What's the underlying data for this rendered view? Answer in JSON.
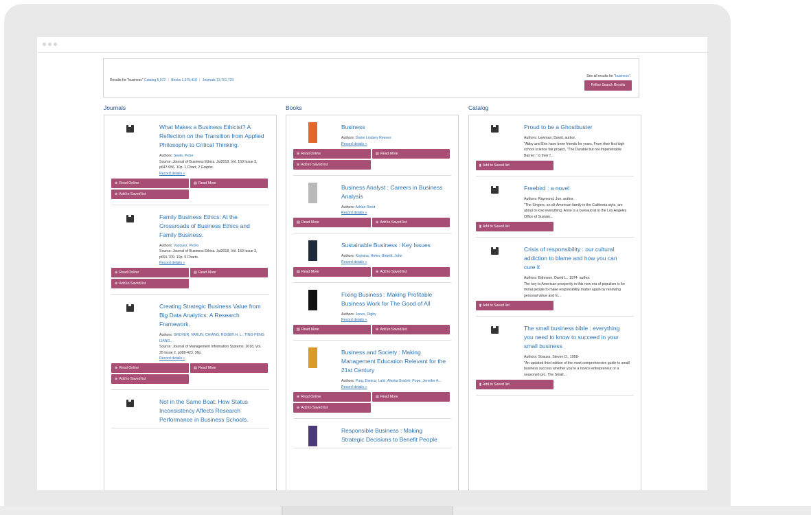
{
  "summary": {
    "results_label": "Results for \"business\"",
    "catalog": "Catalog 5,972",
    "books": "Books 1,376,418",
    "journals": "Journals 13,701,729",
    "see_all_prefix": "See all results for",
    "see_all_link": "\"business\".",
    "refine": "Refine Search Results"
  },
  "columns": {
    "journals": "Journals",
    "books": "Books",
    "catalog": "Catalog"
  },
  "buttons": {
    "read_online": "Read Online",
    "read_more": "Read More",
    "add_saved": "Add to Saved list",
    "record_details": "Record details »",
    "authors_label": "Authors:"
  },
  "journals": [
    {
      "title": "What Makes a Business Ethicist? A Reflection on the Transition from Applied Philosophy to Critical Thinking.",
      "authors": "Seele, Peter",
      "source": "Source: Journal of Business Ethics. Jul2018, Vol. 150 Issue 3, p647-656. 10p. 1 Chart, 2 Graphs."
    },
    {
      "title": "Family Business Ethics: At the Crossroads of Business Ethics and Family Business.",
      "authors": "Vazquez, Pedro",
      "source": "Source: Journal of Business Ethics. Jul2018, Vol. 150 Issue 3, p691-709. 19p. 5 Charts."
    },
    {
      "title": "Creating Strategic Business Value from Big Data Analytics: A Research Framework.",
      "authors": "GROVER, VARUN; CHIANG, ROGER H. L.; TING-PENG LIANG...",
      "source": "Source: Journal of Management Information Systems. 2018, Vol. 35 Issue 2, p388-423. 36p."
    },
    {
      "title": "Not in the Same Boat: How Status Inconsistency Affects Research Performance in Business Schools.",
      "authors": "",
      "source": ""
    }
  ],
  "books": [
    {
      "title": "Business",
      "authors": "Diane Lindsey Reeves",
      "cover_color": "#e0682b"
    },
    {
      "title": "Business Analyst : Careers in Business Analysis",
      "authors": "Adrian Reed",
      "cover_color": "#b9b9b9"
    },
    {
      "title": "Sustainable Business : Key Issues",
      "authors": "Kopnina, Helen; Blewitt, John",
      "cover_color": "#1d2b3a"
    },
    {
      "title": "Fixing Business : Making Profitable Business Work for The Good of All",
      "authors": "Jones, Digby",
      "cover_color": "#111111"
    },
    {
      "title": "Business and Society : Making Management Education Relevant for the 21st Century",
      "authors": "Purg, Danica; Lalić, Alenka Braček; Pope, Jennifer A...",
      "cover_color": "#d99a2a"
    },
    {
      "title": "Responsible Business : Making Strategic Decisions to Benefit People",
      "authors": "",
      "cover_color": "#4b3a7a"
    }
  ],
  "catalog": [
    {
      "title": "Proud to be a Ghostbuster",
      "authors": "Lewman, David, author.",
      "desc": "\"Abby and Erin have been friends for years. From their first high school science fair project, \"The Durable but not Impenetrable Barrier,\" to their f..."
    },
    {
      "title": "Freebird : a novel",
      "authors": "Raymond, Jon, author.",
      "desc": "\"The Singers, an all-American family in the California style, are about to lose everything. Anne is a bureaucrat in the Los Angeles Office of Sustain..."
    },
    {
      "title": "Crisis of responsibility : our cultural addiction to blame and how you can cure it",
      "authors": "Bahnsen, David L., 1974- author.",
      "desc": "The key to American prosperity in this new era of populism is for moral people to make responsibility matter again by renewing personal virtue and fo..."
    },
    {
      "title": "The small business bible : everything you need to know to succeed in your small business",
      "authors": "Strauss, Steven D., 1958-",
      "desc": "\"An updated third edition of the most comprehensive guide to small business success whether you're a novice entrepreneur or a seasoned pro, The Small..."
    }
  ],
  "colors": {
    "accent": "#a84e74",
    "link": "#2a72b5",
    "heading": "#1d4f8a"
  }
}
